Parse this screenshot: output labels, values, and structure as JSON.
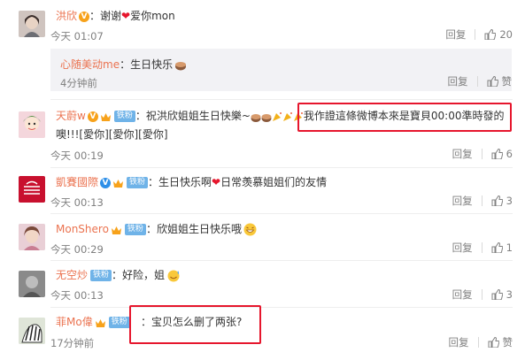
{
  "comments": [
    {
      "username": "洪欣",
      "text_before": "：谢谢",
      "text_after": "爱你mon",
      "time": "今天 01:07",
      "reply_label": "回复",
      "likes": "20",
      "reply": {
        "username": "心随美动me",
        "text": "：生日快乐",
        "time": "4分钟前",
        "reply_label": "回复",
        "like_label": "赞"
      }
    },
    {
      "username": "天蔚w",
      "fan_badge": "铁粉",
      "text_a": "：祝洪欣姐姐生日快樂~",
      "text_b": "我作證這條微博本來是寶貝00:00準時發的",
      "text_c": "噢!!![愛你][愛你][愛你]",
      "time": "今天 00:19",
      "reply_label": "回复",
      "likes": "6"
    },
    {
      "username": "凱賽國際",
      "fan_badge": "铁粉",
      "text_before": "：生日快乐啊",
      "text_after": "日常羡慕姐姐们的友情",
      "time": "今天 00:13",
      "reply_label": "回复",
      "likes": "3"
    },
    {
      "username": "MonShero",
      "fan_badge": "铁粉",
      "text": "：欣姐姐生日快乐哦",
      "time": "今天 00:29",
      "reply_label": "回复",
      "likes": "1"
    },
    {
      "username": "无空炒",
      "fan_badge": "铁粉",
      "text": "：好险，姐",
      "time": "今天 00:13",
      "reply_label": "回复",
      "likes": "3"
    },
    {
      "username": "菲Mo偉",
      "fan_badge": "铁粉",
      "text": "：宝贝怎么删了两张?",
      "time": "17分钟前",
      "reply_label": "回复",
      "like_label": "赞"
    }
  ],
  "colors": {
    "username": "#eb7350",
    "highlight_box": "#e6162d",
    "meta": "#808080"
  }
}
